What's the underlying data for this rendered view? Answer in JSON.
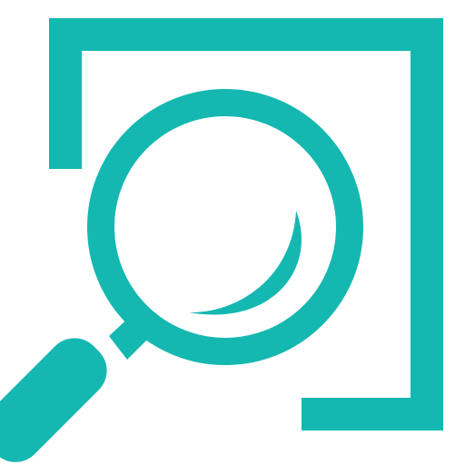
{
  "icon": {
    "name": "search-frame-icon",
    "color": "#14b8b0",
    "parts": [
      "frame-bracket",
      "magnifier-lens",
      "lens-glint",
      "magnifier-handle"
    ]
  }
}
